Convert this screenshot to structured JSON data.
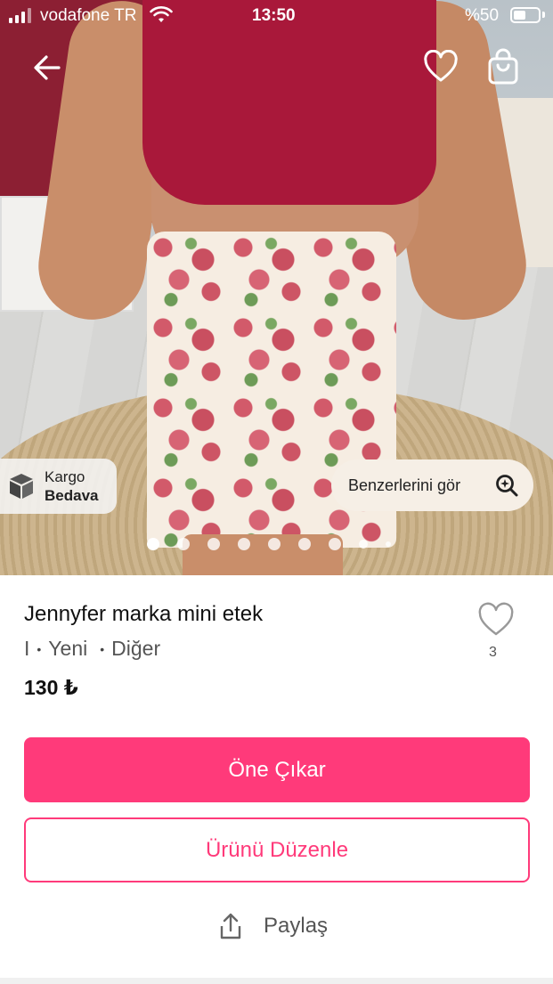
{
  "status_bar": {
    "carrier": "vodafone TR",
    "time": "13:50",
    "battery": "%50"
  },
  "nav": {
    "back_icon": "arrow-left-icon",
    "favorite_icon": "heart-icon",
    "cart_icon": "shopping-bag-icon"
  },
  "photo": {
    "cargo_badge": {
      "line1": "Kargo",
      "line2": "Bedava",
      "icon": "package-icon"
    },
    "similar_button": {
      "label": "Benzerlerini gör",
      "icon": "search-sparkle-icon"
    },
    "carousel_dots": 9,
    "carousel_active": 1
  },
  "product": {
    "title": "Jennyfer marka mini etek",
    "size": "I",
    "condition": "Yeni",
    "brand": "Diğer",
    "price": "130 ₺",
    "like_count": "3"
  },
  "actions": {
    "promote": "Öne Çıkar",
    "edit": "Ürünü Düzenle",
    "share": "Paylaş"
  },
  "colors": {
    "accent": "#ff3a7a",
    "badge_bg": "#f6efe6"
  }
}
